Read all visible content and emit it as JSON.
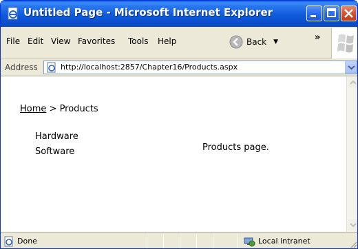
{
  "window": {
    "title": "Untitled Page - Microsoft Internet Explorer"
  },
  "menu": [
    {
      "label": "File"
    },
    {
      "label": "Edit"
    },
    {
      "label": "View"
    },
    {
      "label": "Favorites"
    },
    {
      "label": "Tools"
    },
    {
      "label": "Help"
    }
  ],
  "toolbar": {
    "back_label": "Back",
    "more": "»"
  },
  "address": {
    "label": "Address",
    "url": "http://localhost:2857/Chapter16/Products.aspx"
  },
  "page": {
    "breadcrumb_home": "Home",
    "breadcrumb_sep": " > ",
    "breadcrumb_current": "Products",
    "nav_items": [
      "Hardware",
      "Software"
    ],
    "body_text": "Products page."
  },
  "status": {
    "text": "Done",
    "zone": "Local intranet"
  }
}
